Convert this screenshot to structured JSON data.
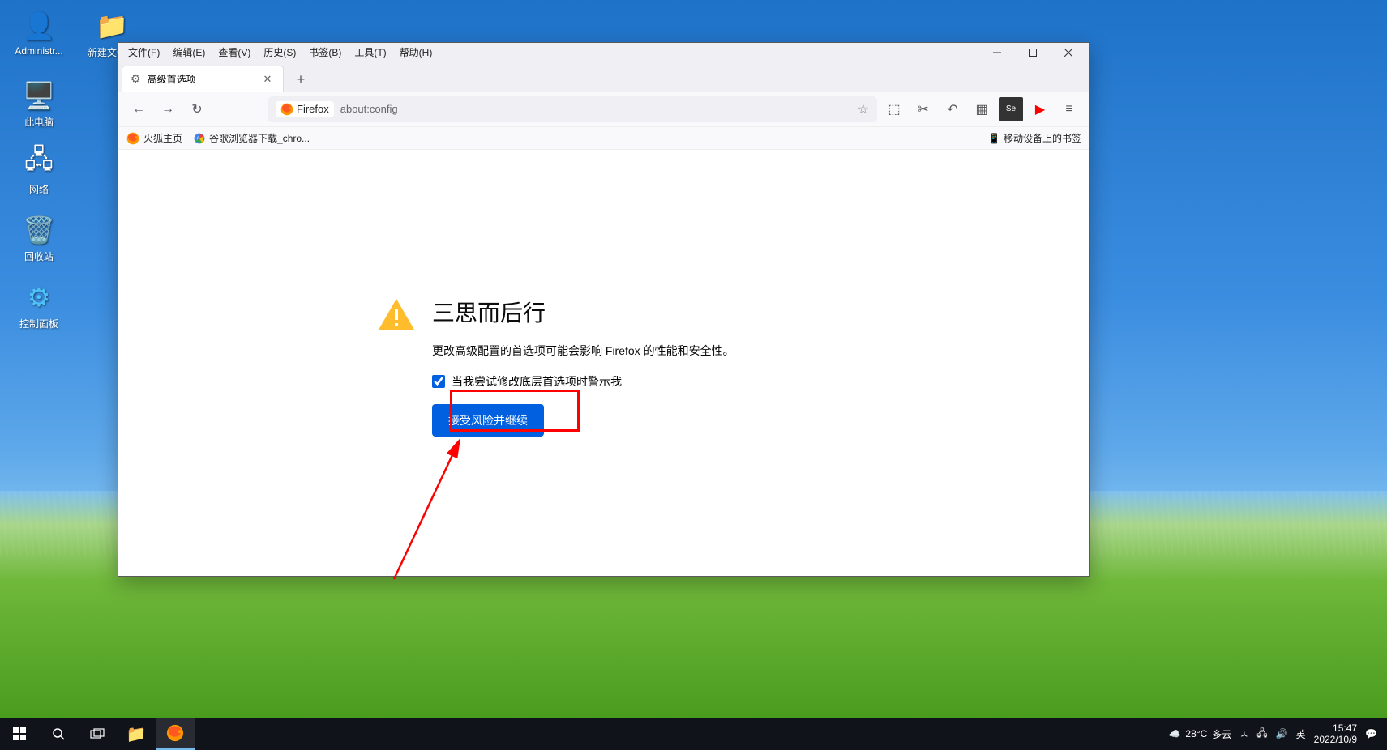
{
  "desktop": {
    "icons": [
      {
        "label": "Administr...",
        "glyph": "👤"
      },
      {
        "label": "新建文件夹",
        "glyph": "📁"
      },
      {
        "label": "此电脑",
        "glyph": "🖥️"
      },
      {
        "label": "网络",
        "glyph": "🖧"
      },
      {
        "label": "回收站",
        "glyph": "🗑️"
      },
      {
        "label": "控制面板",
        "glyph": "⚙"
      }
    ]
  },
  "firefox": {
    "menubar": {
      "items": [
        "文件(F)",
        "编辑(E)",
        "查看(V)",
        "历史(S)",
        "书签(B)",
        "工具(T)",
        "帮助(H)"
      ]
    },
    "tab": {
      "title": "高级首选项"
    },
    "url": {
      "identity_label": "Firefox",
      "value": "about:config"
    },
    "bookmarksbar": {
      "items": [
        "火狐主页",
        "谷歌浏览器下载_chro..."
      ],
      "right_label": "移动设备上的书签"
    },
    "page": {
      "title": "三思而后行",
      "desc": "更改高级配置的首选项可能会影响 Firefox 的性能和安全性。",
      "checkbox_label": "当我尝试修改底层首选项时警示我",
      "button_label": "接受风险并继续"
    }
  },
  "taskbar": {
    "weather_temp": "28°C",
    "weather_cond": "多云",
    "ime": "英",
    "time": "15:47",
    "date": "2022/10/9"
  }
}
